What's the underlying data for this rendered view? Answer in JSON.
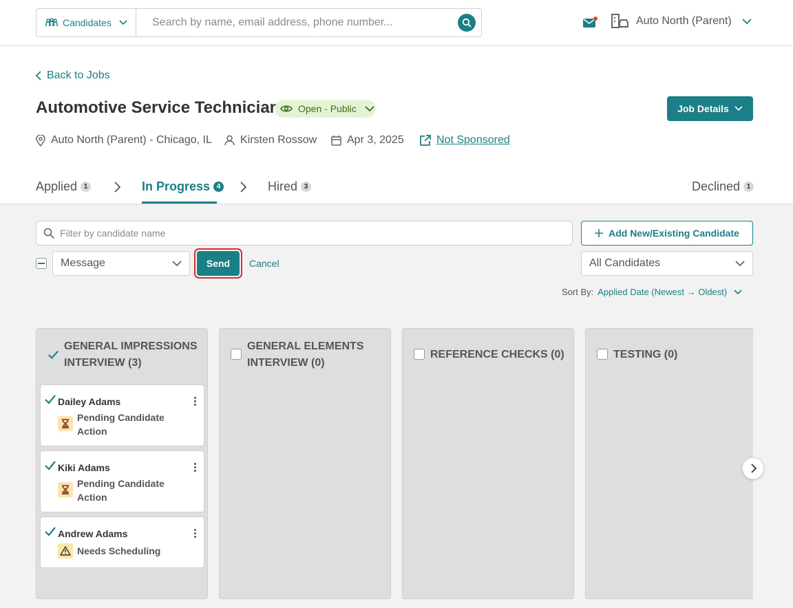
{
  "topbar": {
    "scope_label": "Candidates",
    "search_placeholder": "Search by name, email address, phone number...",
    "org_name": "Auto North (Parent)"
  },
  "header": {
    "back_label": "Back to Jobs",
    "job_title": "Automotive Service Technician",
    "status": "Open - Public",
    "job_details_label": "Job Details",
    "location": "Auto North (Parent) - Chicago, IL",
    "recruiter": "Kirsten Rossow",
    "date": "Apr 3, 2025",
    "sponsor_link": "Not Sponsored"
  },
  "tabs": [
    {
      "label": "Applied",
      "count": "1"
    },
    {
      "label": "In Progress",
      "count": "4"
    },
    {
      "label": "Hired",
      "count": "3"
    },
    {
      "label": "Declined",
      "count": "1"
    }
  ],
  "toolbar": {
    "filter_placeholder": "Filter by candidate name",
    "add_label": "Add New/Existing Candidate",
    "action_select": "Message",
    "send_label": "Send",
    "cancel_label": "Cancel",
    "candidates_select": "All Candidates",
    "sort_label": "Sort By:",
    "sort_value": "Applied Date (Newest → Oldest)"
  },
  "columns": [
    {
      "title": "GENERAL IMPRESSIONS INTERVIEW (3)",
      "checked": true
    },
    {
      "title": "GENERAL ELEMENTS INTERVIEW (0)",
      "checked": false
    },
    {
      "title": "REFERENCE CHECKS (0)",
      "checked": false
    },
    {
      "title": "TESTING (0)",
      "checked": false
    }
  ],
  "cards": [
    {
      "name": "Dailey Adams",
      "status": "Pending Candidate Action",
      "icon": "hourglass-icon"
    },
    {
      "name": "Kiki Adams",
      "status": "Pending Candidate Action",
      "icon": "hourglass-icon"
    },
    {
      "name": "Andrew Adams",
      "status": "Needs Scheduling",
      "icon": "warning-icon"
    }
  ],
  "colors": {
    "accent": "#1a7f86",
    "highlight": "#d32f2f",
    "status_pill": "#e3f3d4"
  }
}
